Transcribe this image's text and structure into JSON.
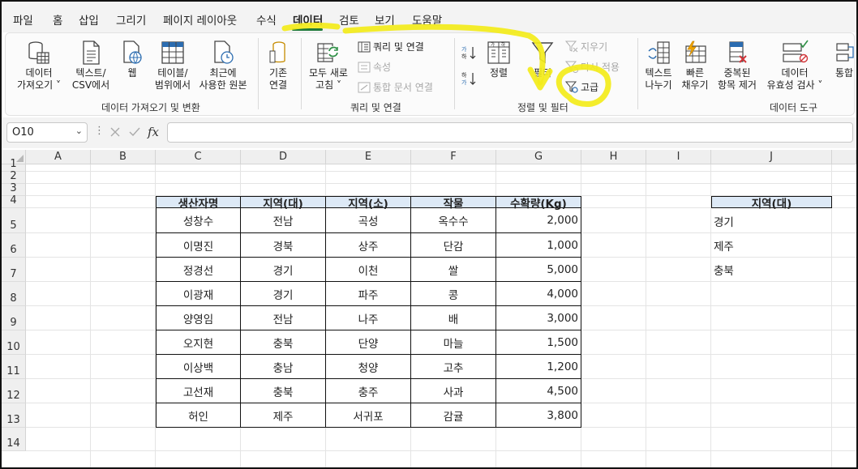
{
  "menu": {
    "tabs": [
      {
        "label": "파일",
        "active": false
      },
      {
        "label": "홈",
        "active": false
      },
      {
        "label": "삽입",
        "active": false
      },
      {
        "label": "그리기",
        "active": false
      },
      {
        "label": "페이지 레이아웃",
        "active": false
      },
      {
        "label": "수식",
        "active": false
      },
      {
        "label": "데이터",
        "active": true
      },
      {
        "label": "검토",
        "active": false
      },
      {
        "label": "보기",
        "active": false
      },
      {
        "label": "도움말",
        "active": false
      }
    ],
    "accent_color": "#1f7a3a"
  },
  "ribbon": {
    "get_data": {
      "line1": "데이터",
      "line2": "가져오기 ˅"
    },
    "from_text_csv": {
      "line1": "텍스트/",
      "line2": "CSV에서"
    },
    "from_web": {
      "line1": "웹"
    },
    "from_table": {
      "line1": "테이블/",
      "line2": "범위에서"
    },
    "recent_sources": {
      "line1": "최근에",
      "line2": "사용한 원본"
    },
    "existing_conn": {
      "line1": "기존",
      "line2": "연결"
    },
    "group_get_transform": "데이터 가져오기 및 변환",
    "refresh_all": {
      "line1": "모두 새로",
      "line2": "고침 ˅"
    },
    "queries_connections": "쿼리 및 연결",
    "properties": "속성",
    "edit_links": "통합 문서 연결",
    "group_queries": "쿼리 및 연결",
    "sort": "정렬",
    "filter": "필터",
    "clear": "지우기",
    "reapply": "다시 적용",
    "advanced": "고급",
    "group_sort_filter": "정렬 및 필터",
    "text_to_columns": {
      "line1": "텍스트",
      "line2": "나누기"
    },
    "flash_fill": {
      "line1": "빠른",
      "line2": "채우기"
    },
    "remove_duplicates": {
      "line1": "중복된",
      "line2": "항목 제거"
    },
    "data_validation": {
      "line1": "데이터",
      "line2": "유효성 검사 ˅"
    },
    "consolidate": {
      "line1": "통합"
    },
    "group_data_tools": "데이터 도구"
  },
  "formula_bar": {
    "name_box": "O10",
    "formula": "",
    "fx_label": "fx"
  },
  "columns": [
    "A",
    "B",
    "C",
    "D",
    "E",
    "F",
    "G",
    "H",
    "I",
    "J"
  ],
  "rows": [
    "1",
    "2",
    "3",
    "4",
    "5",
    "6",
    "7",
    "8",
    "9",
    "10",
    "11",
    "12",
    "13",
    "14"
  ],
  "table": {
    "headers": [
      "생산자명",
      "지역(대)",
      "지역(소)",
      "작물",
      "수확량(Kg)"
    ],
    "rows": [
      [
        "성창수",
        "전남",
        "곡성",
        "옥수수",
        "2,000"
      ],
      [
        "이명진",
        "경북",
        "상주",
        "단감",
        "1,000"
      ],
      [
        "정경선",
        "경기",
        "이천",
        "쌀",
        "5,000"
      ],
      [
        "이광재",
        "경기",
        "파주",
        "콩",
        "4,000"
      ],
      [
        "양영임",
        "전남",
        "나주",
        "배",
        "3,000"
      ],
      [
        "오지현",
        "충북",
        "단양",
        "마늘",
        "1,500"
      ],
      [
        "이상백",
        "충남",
        "청양",
        "고추",
        "1,200"
      ],
      [
        "고선재",
        "충북",
        "충주",
        "사과",
        "4,500"
      ],
      [
        "허인",
        "제주",
        "서귀포",
        "감귤",
        "3,800"
      ]
    ],
    "header_fill": "#dde9f6"
  },
  "criteria": {
    "header": "지역(대)",
    "values": [
      "경기",
      "제주",
      "충북"
    ]
  },
  "annotation_color": "#f3ec1a"
}
